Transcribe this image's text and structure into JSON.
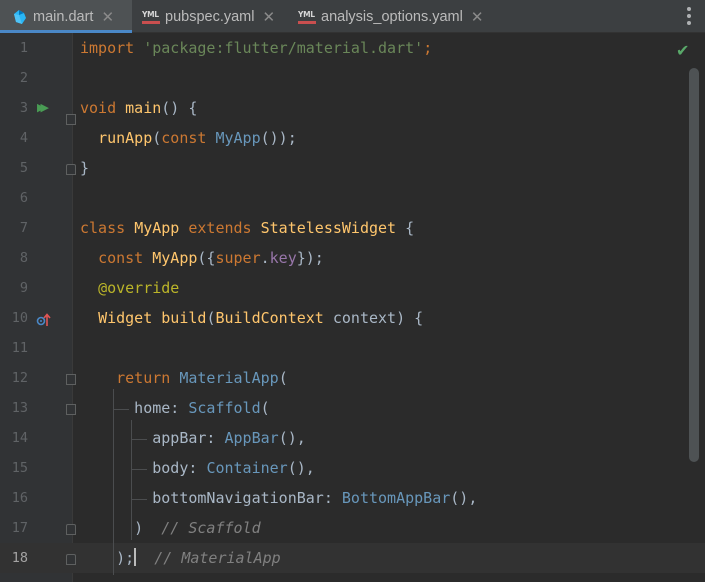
{
  "tabs": [
    {
      "label": "main.dart",
      "icon": "dart-icon",
      "active": true
    },
    {
      "label": "pubspec.yaml",
      "icon": "yaml-icon",
      "active": false
    },
    {
      "label": "analysis_options.yaml",
      "icon": "yaml-icon",
      "active": false
    }
  ],
  "tab_icon_text": "YML",
  "close_glyph": "✕",
  "status": {
    "check_glyph": "✔",
    "color": "#59a869"
  },
  "colors": {
    "keyword": "#cc7832",
    "string": "#6a8759",
    "function": "#ffc66d",
    "class": "#6897bb",
    "property": "#9876aa",
    "comment": "#808080",
    "annotation": "#bbb529",
    "tab_underline": "#4a88c7"
  },
  "lines": [
    {
      "n": "1",
      "tokens": [
        {
          "t": "import ",
          "c": "kw"
        },
        {
          "t": "'package:flutter/material.dart'",
          "c": "str"
        },
        {
          "t": ";",
          "c": "kw"
        }
      ]
    },
    {
      "n": "2",
      "tokens": []
    },
    {
      "n": "3",
      "tokens": [
        {
          "t": "void ",
          "c": "kw"
        },
        {
          "t": "main",
          "c": "fn"
        },
        {
          "t": "() {",
          "c": ""
        }
      ]
    },
    {
      "n": "4",
      "tokens": [
        {
          "t": "  "
        },
        {
          "t": "runApp",
          "c": "fn"
        },
        {
          "t": "("
        },
        {
          "t": "const ",
          "c": "kw"
        },
        {
          "t": "MyApp",
          "c": "cls"
        },
        {
          "t": "());"
        }
      ]
    },
    {
      "n": "5",
      "tokens": [
        {
          "t": "}"
        }
      ]
    },
    {
      "n": "6",
      "tokens": []
    },
    {
      "n": "7",
      "tokens": [
        {
          "t": "class ",
          "c": "kw"
        },
        {
          "t": "MyApp ",
          "c": "fn"
        },
        {
          "t": "extends ",
          "c": "kw"
        },
        {
          "t": "StatelessWidget",
          "c": "fn"
        },
        {
          "t": " {"
        }
      ]
    },
    {
      "n": "8",
      "tokens": [
        {
          "t": "  "
        },
        {
          "t": "const ",
          "c": "kw"
        },
        {
          "t": "MyApp",
          "c": "fn"
        },
        {
          "t": "({"
        },
        {
          "t": "super",
          "c": "kw"
        },
        {
          "t": "."
        },
        {
          "t": "key",
          "c": "lit"
        },
        {
          "t": "});"
        }
      ]
    },
    {
      "n": "9",
      "tokens": [
        {
          "t": "  "
        },
        {
          "t": "@override",
          "c": "ann"
        }
      ]
    },
    {
      "n": "10",
      "tokens": [
        {
          "t": "  "
        },
        {
          "t": "Widget ",
          "c": "fn"
        },
        {
          "t": "build",
          "c": "fn"
        },
        {
          "t": "("
        },
        {
          "t": "BuildContext",
          "c": "fn"
        },
        {
          "t": " context) {"
        }
      ]
    },
    {
      "n": "11",
      "tokens": []
    },
    {
      "n": "12",
      "tokens": [
        {
          "t": "    "
        },
        {
          "t": "return ",
          "c": "kw"
        },
        {
          "t": "MaterialApp",
          "c": "cls"
        },
        {
          "t": "("
        }
      ]
    },
    {
      "n": "13",
      "tokens": [
        {
          "t": "      home: "
        },
        {
          "t": "Scaffold",
          "c": "cls"
        },
        {
          "t": "("
        }
      ]
    },
    {
      "n": "14",
      "tokens": [
        {
          "t": "        appBar: "
        },
        {
          "t": "AppBar",
          "c": "cls"
        },
        {
          "t": "(),"
        }
      ]
    },
    {
      "n": "15",
      "tokens": [
        {
          "t": "        body: "
        },
        {
          "t": "Container",
          "c": "cls"
        },
        {
          "t": "(),"
        }
      ]
    },
    {
      "n": "16",
      "tokens": [
        {
          "t": "        bottomNavigationBar: "
        },
        {
          "t": "BottomAppBar",
          "c": "cls"
        },
        {
          "t": "(),"
        }
      ]
    },
    {
      "n": "17",
      "tokens": [
        {
          "t": "      )  "
        },
        {
          "t": "// Scaffold",
          "c": "cmt"
        }
      ]
    },
    {
      "n": "18",
      "tokens": [
        {
          "t": "    );"
        },
        {
          "t": "",
          "c": "cursor"
        },
        {
          "t": "  "
        },
        {
          "t": "// MaterialApp",
          "c": "cmt"
        }
      ]
    }
  ]
}
